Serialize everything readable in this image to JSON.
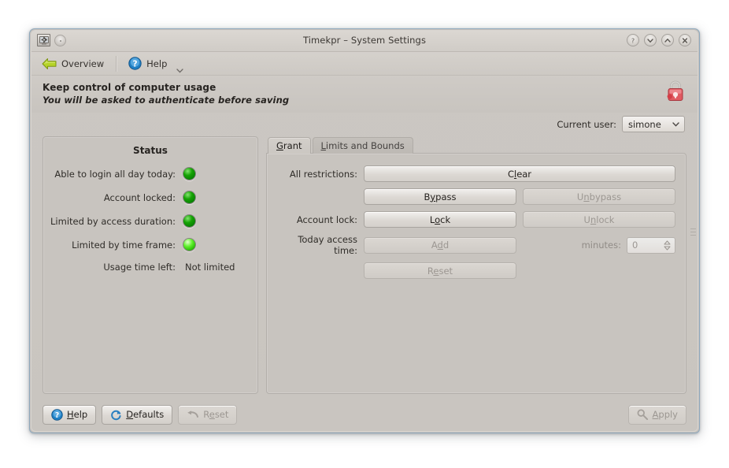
{
  "window": {
    "title": "Timekpr – System Settings",
    "app_icon": "settings-gear-icon",
    "buttons": {
      "help": "?",
      "minimize": "v",
      "maximize": "^",
      "close": "x"
    }
  },
  "toolbar": {
    "overview_label": "Overview",
    "overview_icon": "back-arrow-icon",
    "help_label": "Help",
    "help_icon": "help-circle-icon",
    "dropdown_icon": "chevron-down-icon"
  },
  "header": {
    "title": "Keep control of computer usage",
    "subtitle": "You will be asked to authenticate before saving",
    "lock_icon": "padlock-icon",
    "lock_color": "#e0565c"
  },
  "user": {
    "label": "Current user:",
    "selected": "simone",
    "options": [
      "simone"
    ]
  },
  "status": {
    "title": "Status",
    "rows": [
      {
        "label": "Able to login all day today:",
        "state": "off"
      },
      {
        "label": "Account locked:",
        "state": "off"
      },
      {
        "label": "Limited by access duration:",
        "state": "off"
      },
      {
        "label": "Limited by time frame:",
        "state": "on"
      }
    ],
    "usage_label": "Usage time left:",
    "usage_value": "Not limited"
  },
  "tabs": [
    {
      "label": "Grant",
      "mnemonic": "G",
      "active": true
    },
    {
      "label": "Limits and Bounds",
      "mnemonic": "L",
      "active": false
    }
  ],
  "grant": {
    "rows": [
      {
        "label": "All restrictions:",
        "label_disabled": false,
        "primary": {
          "pre": "C",
          "mn": "l",
          "post": "ear",
          "disabled": false,
          "full": true
        },
        "secondary": null
      },
      {
        "label": "",
        "label_disabled": false,
        "primary": {
          "pre": "B",
          "mn": "y",
          "post": "pass",
          "disabled": false,
          "full": false
        },
        "secondary": {
          "pre": "U",
          "mn": "n",
          "post": "bypass",
          "disabled": true,
          "full": false
        }
      },
      {
        "label": "Account lock:",
        "label_disabled": false,
        "primary": {
          "pre": "L",
          "mn": "o",
          "post": "ck",
          "disabled": false,
          "full": false
        },
        "secondary": {
          "pre": "U",
          "mn": "n",
          "post": "lock",
          "disabled": true,
          "full": false
        }
      },
      {
        "label": "Today access time:",
        "label_disabled": false,
        "primary": {
          "pre": "A",
          "mn": "d",
          "post": "d",
          "disabled": true,
          "full": false
        },
        "secondary": null
      },
      {
        "label": "",
        "label_disabled": false,
        "primary": {
          "pre": "R",
          "mn": "e",
          "post": "set",
          "disabled": true,
          "full": false
        },
        "secondary": null
      }
    ],
    "minutes_label": "minutes:",
    "minutes_value": "0",
    "minutes_disabled": true
  },
  "footer": {
    "help_label": "Help",
    "help_mnemonic": "H",
    "help_icon": "help-circle-icon",
    "defaults_label": "Defaults",
    "defaults_mnemonic": "D",
    "defaults_icon": "refresh-icon",
    "reset_label": "Reset",
    "reset_mnemonic": "e",
    "reset_icon": "undo-arrow-icon",
    "reset_disabled": true,
    "apply_label": "Apply",
    "apply_mnemonic": "A",
    "apply_icon": "key-icon",
    "apply_disabled": true
  }
}
